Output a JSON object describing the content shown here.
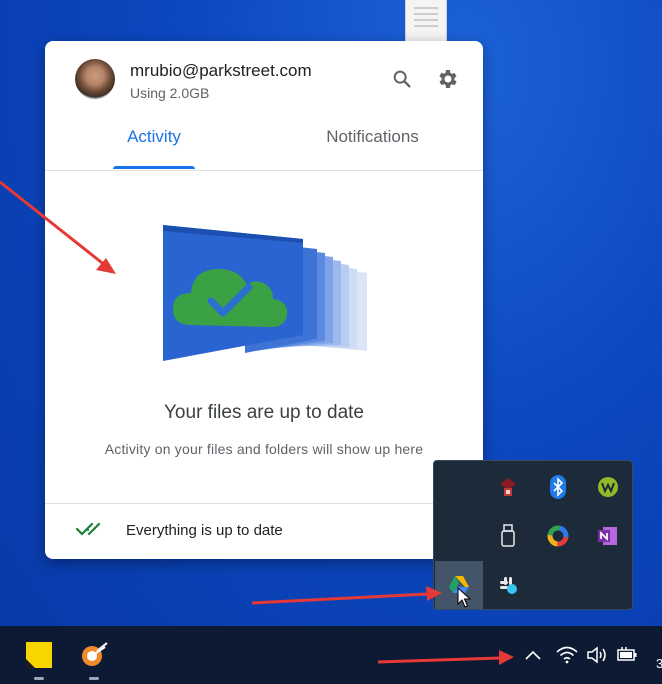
{
  "account": {
    "email": "mrubio@parkstreet.com",
    "usage": "Using 2.0GB"
  },
  "tabs": [
    {
      "label": "Activity",
      "selected": true
    },
    {
      "label": "Notifications",
      "selected": false
    }
  ],
  "main": {
    "title": "Your files are up to date",
    "subtitle": "Activity on your files and folders will show up here"
  },
  "footer": {
    "status": "Everything is up to date"
  },
  "tray_icons": [
    "security-shield-icon",
    "bluetooth-icon",
    "w-app-icon",
    "usb-drive-icon",
    "colorful-ring-icon",
    "onenote-icon",
    "google-drive-icon",
    "slack-icon"
  ],
  "taskbar": {
    "apps": [
      "sticky-notes-icon",
      "snipping-tool-icon"
    ],
    "clock_fragment": "3"
  },
  "colors": {
    "accent": "#1a73e8",
    "annotation_arrow": "#e53935",
    "taskbar": "#0c1b33",
    "desktop": "#0b47bf"
  }
}
